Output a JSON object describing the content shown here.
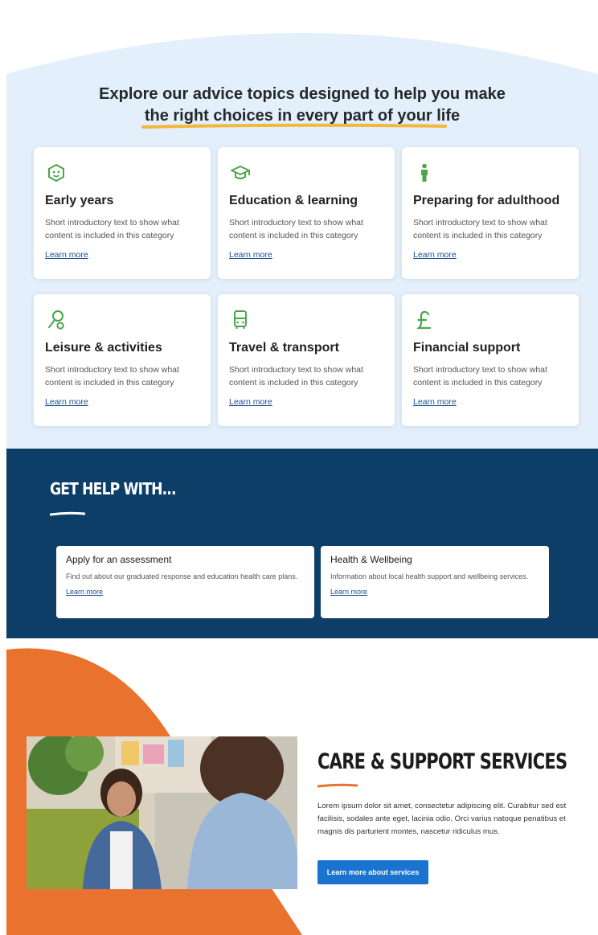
{
  "topics": {
    "heading_line1": "Explore our advice topics designed to help you make",
    "heading_line2": "the right choices in every part of your life",
    "cards": [
      {
        "title": "Early years",
        "desc": "Short introductory text to show what content is included in this category",
        "link": "Learn more",
        "icon": "baby-face-icon"
      },
      {
        "title": "Education & learning",
        "desc": "Short introductory text to show what content is included in this category",
        "link": "Learn more",
        "icon": "graduation-cap-icon"
      },
      {
        "title": "Preparing for adulthood",
        "desc": "Short introductory text to show what content is included in this category",
        "link": "Learn more",
        "icon": "person-icon"
      },
      {
        "title": "Leisure & activities",
        "desc": "Short introductory text to show what content is included in this category",
        "link": "Learn more",
        "icon": "activity-icon"
      },
      {
        "title": "Travel & transport",
        "desc": "Short introductory text to show what content is included in this category",
        "link": "Learn more",
        "icon": "bus-icon"
      },
      {
        "title": "Financial support",
        "desc": "Short introductory text to show what content is included in this category",
        "link": "Learn more",
        "icon": "pound-icon"
      }
    ]
  },
  "help": {
    "title": "GET HELP WITH...",
    "cards": [
      {
        "title": "Apply for an assessment",
        "desc": "Find out about our graduated response and education health care plans.",
        "link": "Learn more"
      },
      {
        "title": "Health & Wellbeing",
        "desc": "Information about local health support and wellbeing services.",
        "link": "Learn more"
      }
    ]
  },
  "care": {
    "title": "CARE & SUPPORT SERVICES",
    "body": "Lorem ipsum dolor sit amet, consectetur adipiscing elit. Curabitur sed est facilisis, sodales ante eget, lacinia odio. Orci varius natoque penatibus et magnis dis parturient montes, nascetur ridiculus mus.",
    "button": "Learn more about services"
  },
  "colors": {
    "topics_bg": "#e3effa",
    "icon_green": "#4aa64a",
    "underline_yellow": "#f2b83a",
    "help_bg": "#0c3e67",
    "accent_orange": "#e8722e",
    "button_blue": "#1a74cf",
    "link_blue": "#1d4f8f"
  }
}
